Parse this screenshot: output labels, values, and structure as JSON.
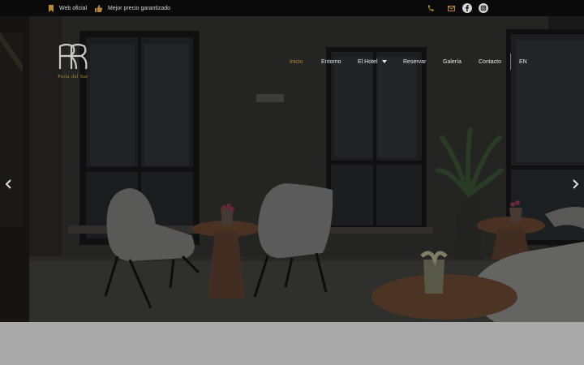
{
  "topbar": {
    "official_web": "Web oficial",
    "best_price": "Mejor precio garantizado"
  },
  "brand": {
    "name": "Perla del Sur",
    "accent_color": "#b8883a"
  },
  "nav": {
    "items": [
      "Inicio",
      "Entorno",
      "El Hotel",
      "Reservar",
      "Galería",
      "Contacto"
    ],
    "language": "EN"
  },
  "icons": {
    "topbar_left": [
      "bookmark-icon",
      "thumbs-up-icon"
    ],
    "topbar_right": [
      "phone-icon",
      "mail-icon",
      "facebook-icon",
      "instagram-icon"
    ],
    "slider": [
      "chevron-left-icon",
      "chevron-right-icon"
    ]
  }
}
